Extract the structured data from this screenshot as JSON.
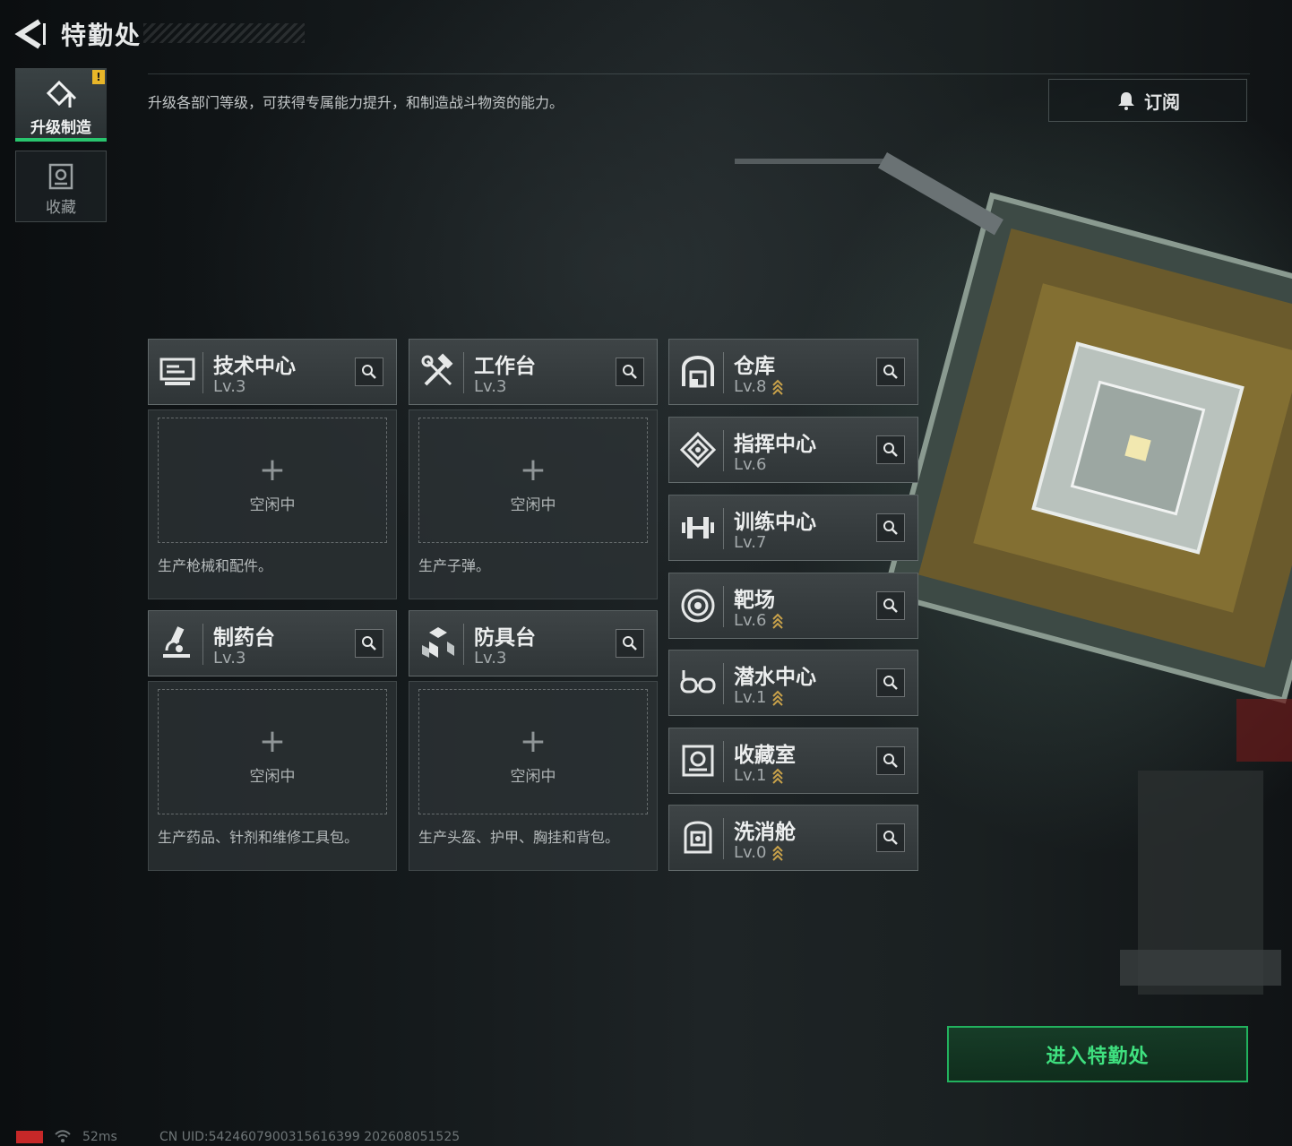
{
  "header": {
    "title": "特勤处"
  },
  "description": "升级各部门等级，可获得专属能力提升，和制造战斗物资的能力。",
  "subscribe": {
    "label": "订阅",
    "icon": "bell-icon"
  },
  "sidebar": {
    "tabs": [
      {
        "label": "升级制造",
        "icon": "upgrade-icon",
        "active": true,
        "badge": "!"
      },
      {
        "label": "收藏",
        "icon": "collection-icon",
        "active": false
      }
    ]
  },
  "production": [
    {
      "name": "技术中心",
      "level": "Lv.3",
      "icon": "monitor-icon",
      "status": "空闲中",
      "desc": "生产枪械和配件。"
    },
    {
      "name": "工作台",
      "level": "Lv.3",
      "icon": "tools-icon",
      "status": "空闲中",
      "desc": "生产子弹。"
    },
    {
      "name": "制药台",
      "level": "Lv.3",
      "icon": "microscope-icon",
      "status": "空闲中",
      "desc": "生产药品、针剂和维修工具包。"
    },
    {
      "name": "防具台",
      "level": "Lv.3",
      "icon": "armor-icon",
      "status": "空闲中",
      "desc": "生产头盔、护甲、胸挂和背包。"
    }
  ],
  "facilities": [
    {
      "name": "仓库",
      "level": "Lv.8",
      "icon": "warehouse-icon",
      "upgradable": true
    },
    {
      "name": "指挥中心",
      "level": "Lv.6",
      "icon": "command-icon",
      "upgradable": false
    },
    {
      "name": "训练中心",
      "level": "Lv.7",
      "icon": "dumbbell-icon",
      "upgradable": false
    },
    {
      "name": "靶场",
      "level": "Lv.6",
      "icon": "target-icon",
      "upgradable": true
    },
    {
      "name": "潜水中心",
      "level": "Lv.1",
      "icon": "dive-goggles-icon",
      "upgradable": true
    },
    {
      "name": "收藏室",
      "level": "Lv.1",
      "icon": "vault-icon",
      "upgradable": true
    },
    {
      "name": "洗消舱",
      "level": "Lv.0",
      "icon": "decontam-icon",
      "upgradable": true
    }
  ],
  "enter_button": {
    "label": "进入特勤处"
  },
  "status_bar": {
    "ping": "52ms",
    "uid": "CN UID:5424607900315616399 202608051525"
  },
  "colors": {
    "accent_green": "#29c56e",
    "badge_yellow": "#e8b629",
    "upgrade_gold": "#c9a24a"
  }
}
